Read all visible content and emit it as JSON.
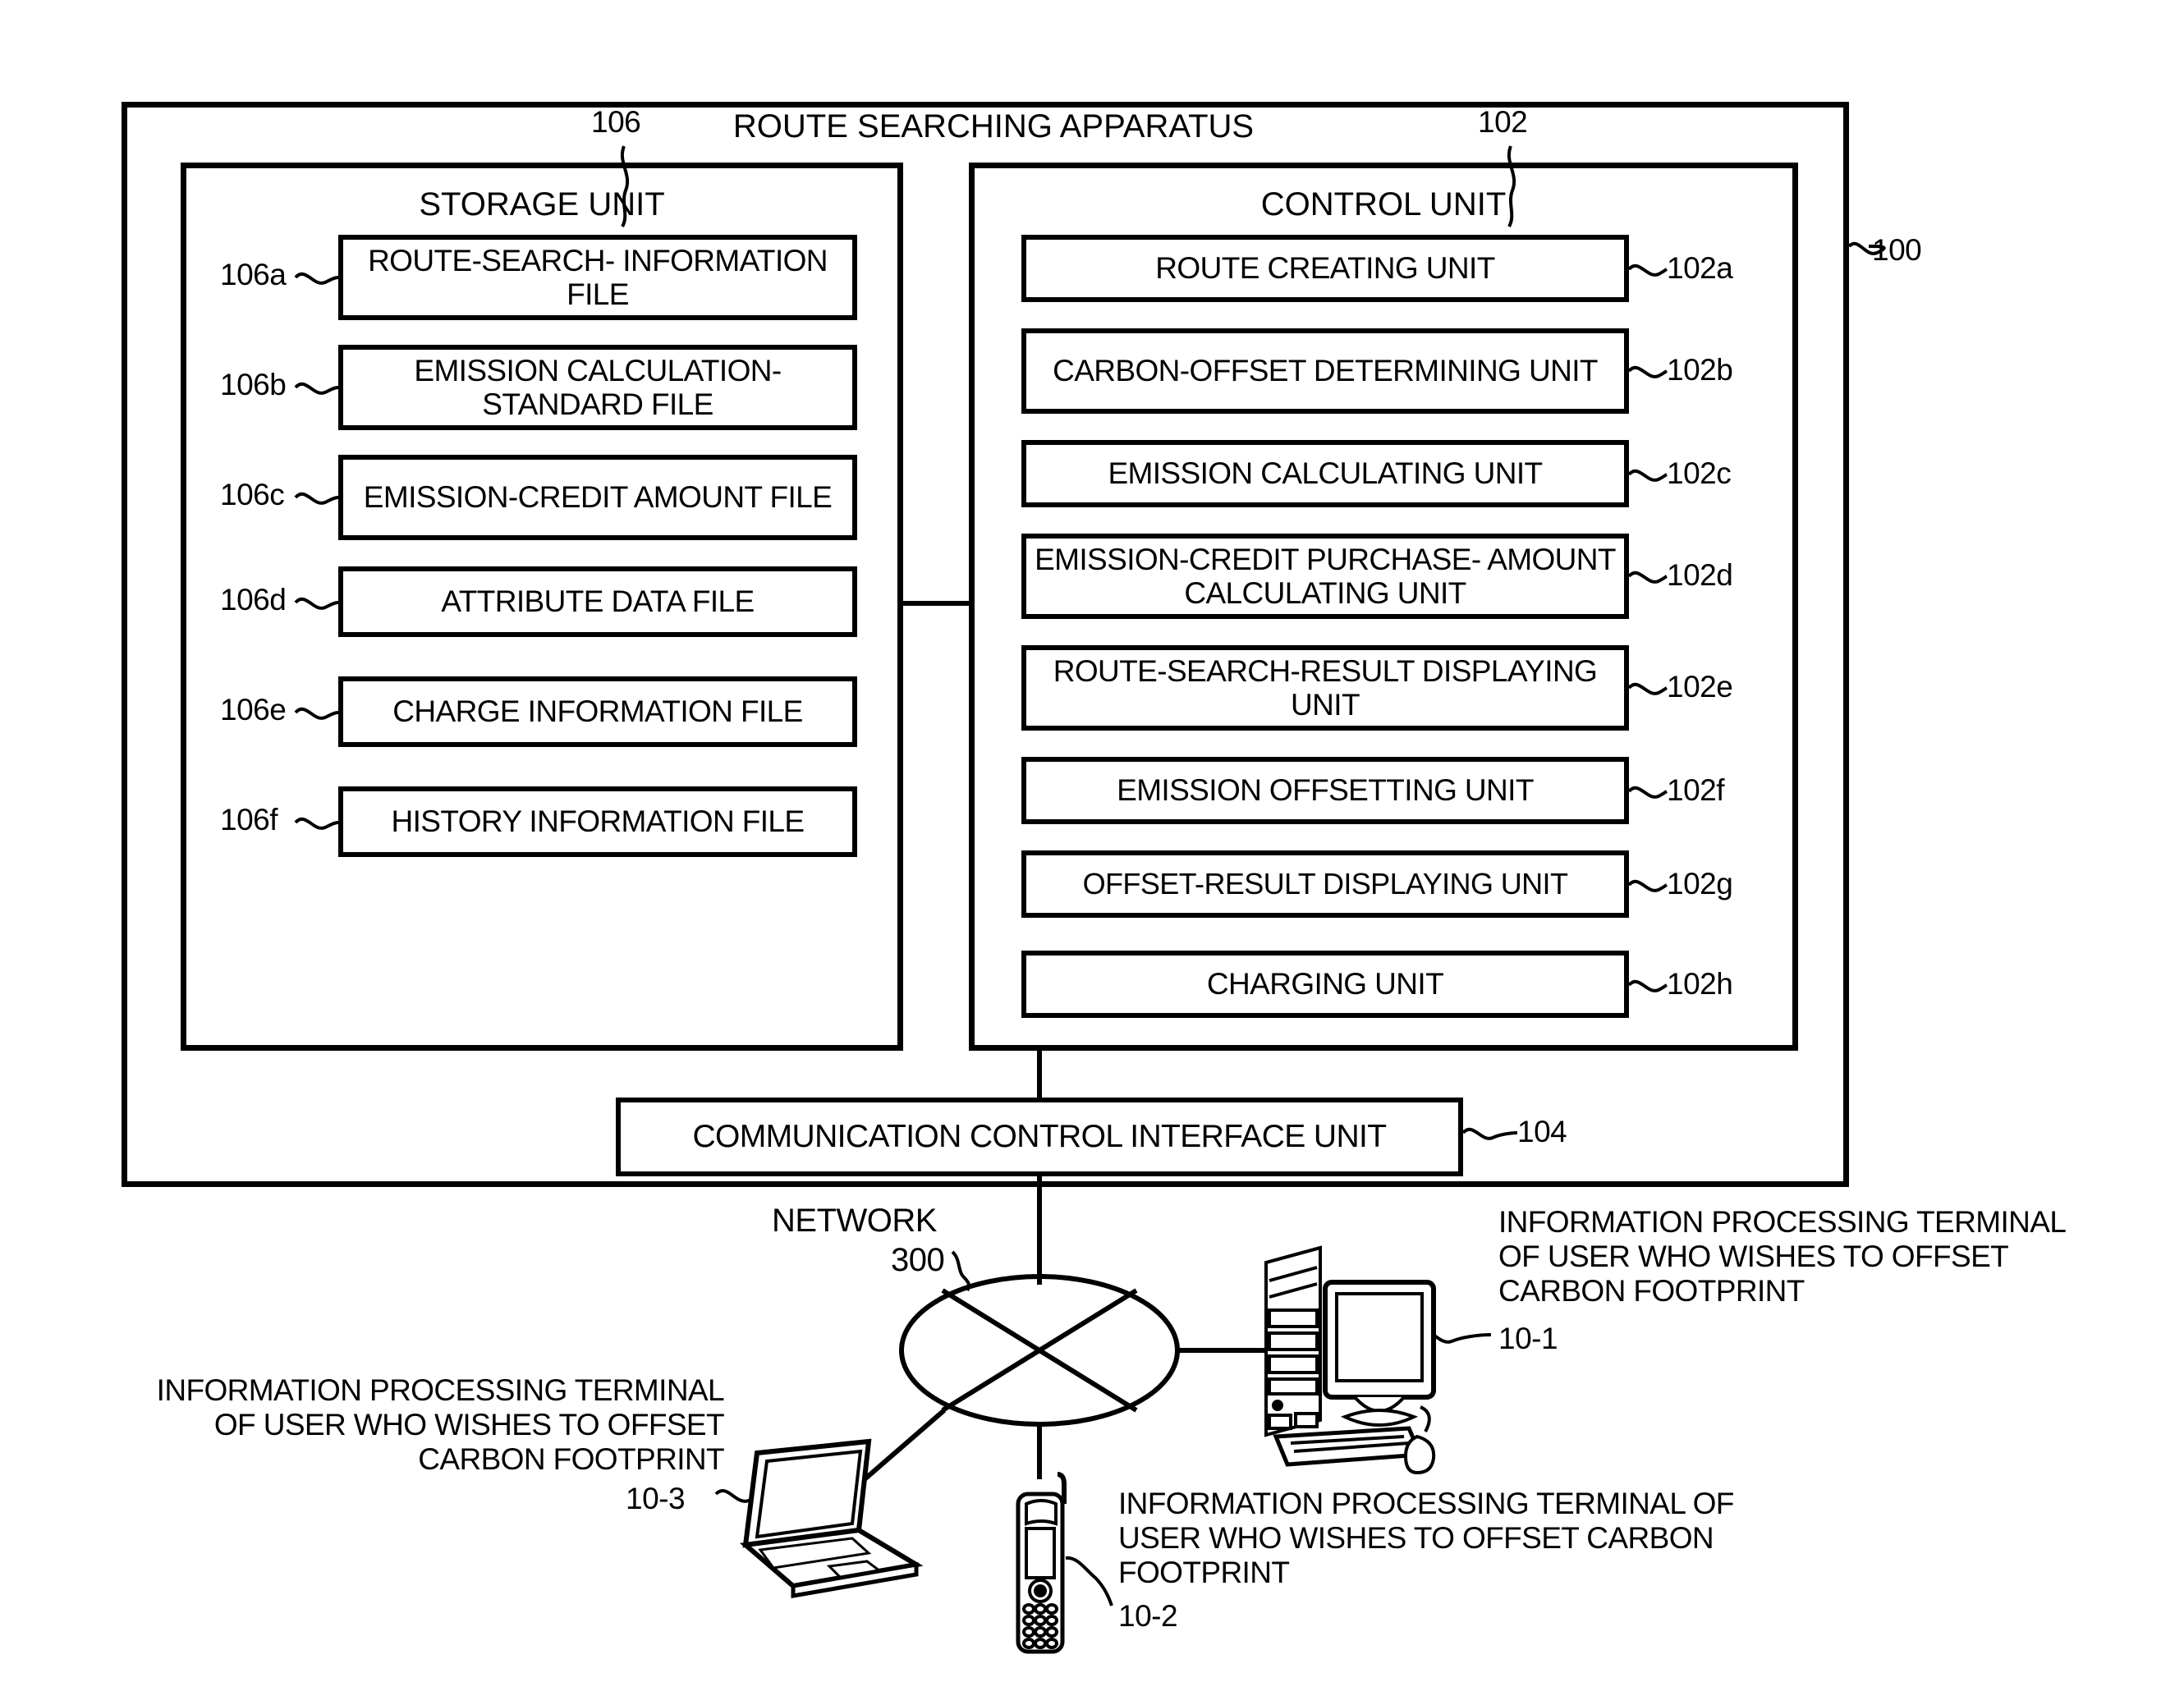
{
  "figure": {
    "apparatus_title": "ROUTE SEARCHING APPARATUS",
    "apparatus_ref": "100",
    "storage_ref": "106",
    "control_ref": "102",
    "comm_ref": "104",
    "network_label": "NETWORK",
    "network_ref": "300"
  },
  "storage_unit": {
    "title": "STORAGE UNIT",
    "files": [
      {
        "ref": "106a",
        "label": "ROUTE-SEARCH-\nINFORMATION FILE"
      },
      {
        "ref": "106b",
        "label": "EMISSION CALCULATION-\nSTANDARD FILE"
      },
      {
        "ref": "106c",
        "label": "EMISSION-CREDIT AMOUNT\nFILE"
      },
      {
        "ref": "106d",
        "label": "ATTRIBUTE DATA FILE"
      },
      {
        "ref": "106e",
        "label": "CHARGE INFORMATION FILE"
      },
      {
        "ref": "106f",
        "label": "HISTORY INFORMATION FILE"
      }
    ]
  },
  "control_unit": {
    "title": "CONTROL UNIT",
    "units": [
      {
        "ref": "102a",
        "label": "ROUTE CREATING UNIT"
      },
      {
        "ref": "102b",
        "label": "CARBON-OFFSET DETERMINING\nUNIT"
      },
      {
        "ref": "102c",
        "label": "EMISSION CALCULATING UNIT"
      },
      {
        "ref": "102d",
        "label": "EMISSION-CREDIT PURCHASE-\nAMOUNT CALCULATING UNIT"
      },
      {
        "ref": "102e",
        "label": "ROUTE-SEARCH-RESULT\nDISPLAYING UNIT"
      },
      {
        "ref": "102f",
        "label": "EMISSION OFFSETTING UNIT"
      },
      {
        "ref": "102g",
        "label": "OFFSET-RESULT DISPLAYING UNIT"
      },
      {
        "ref": "102h",
        "label": "CHARGING UNIT"
      }
    ]
  },
  "comm_unit": {
    "label": "COMMUNICATION CONTROL INTERFACE UNIT"
  },
  "terminals": [
    {
      "id": "desktop",
      "ref": "10-1",
      "caption": "INFORMATION PROCESSING TERMINAL\nOF USER WHO WISHES TO OFFSET\nCARBON FOOTPRINT",
      "icon": "desktop-computer-icon"
    },
    {
      "id": "mobile",
      "ref": "10-2",
      "caption": "INFORMATION PROCESSING TERMINAL OF\nUSER WHO WISHES TO OFFSET CARBON\nFOOTPRINT",
      "icon": "mobile-phone-icon"
    },
    {
      "id": "laptop",
      "ref": "10-3",
      "caption": "INFORMATION PROCESSING TERMINAL\nOF USER WHO WISHES TO OFFSET\nCARBON FOOTPRINT",
      "icon": "laptop-computer-icon"
    }
  ],
  "colors": {
    "ink": "#000000",
    "paper": "#ffffff"
  }
}
